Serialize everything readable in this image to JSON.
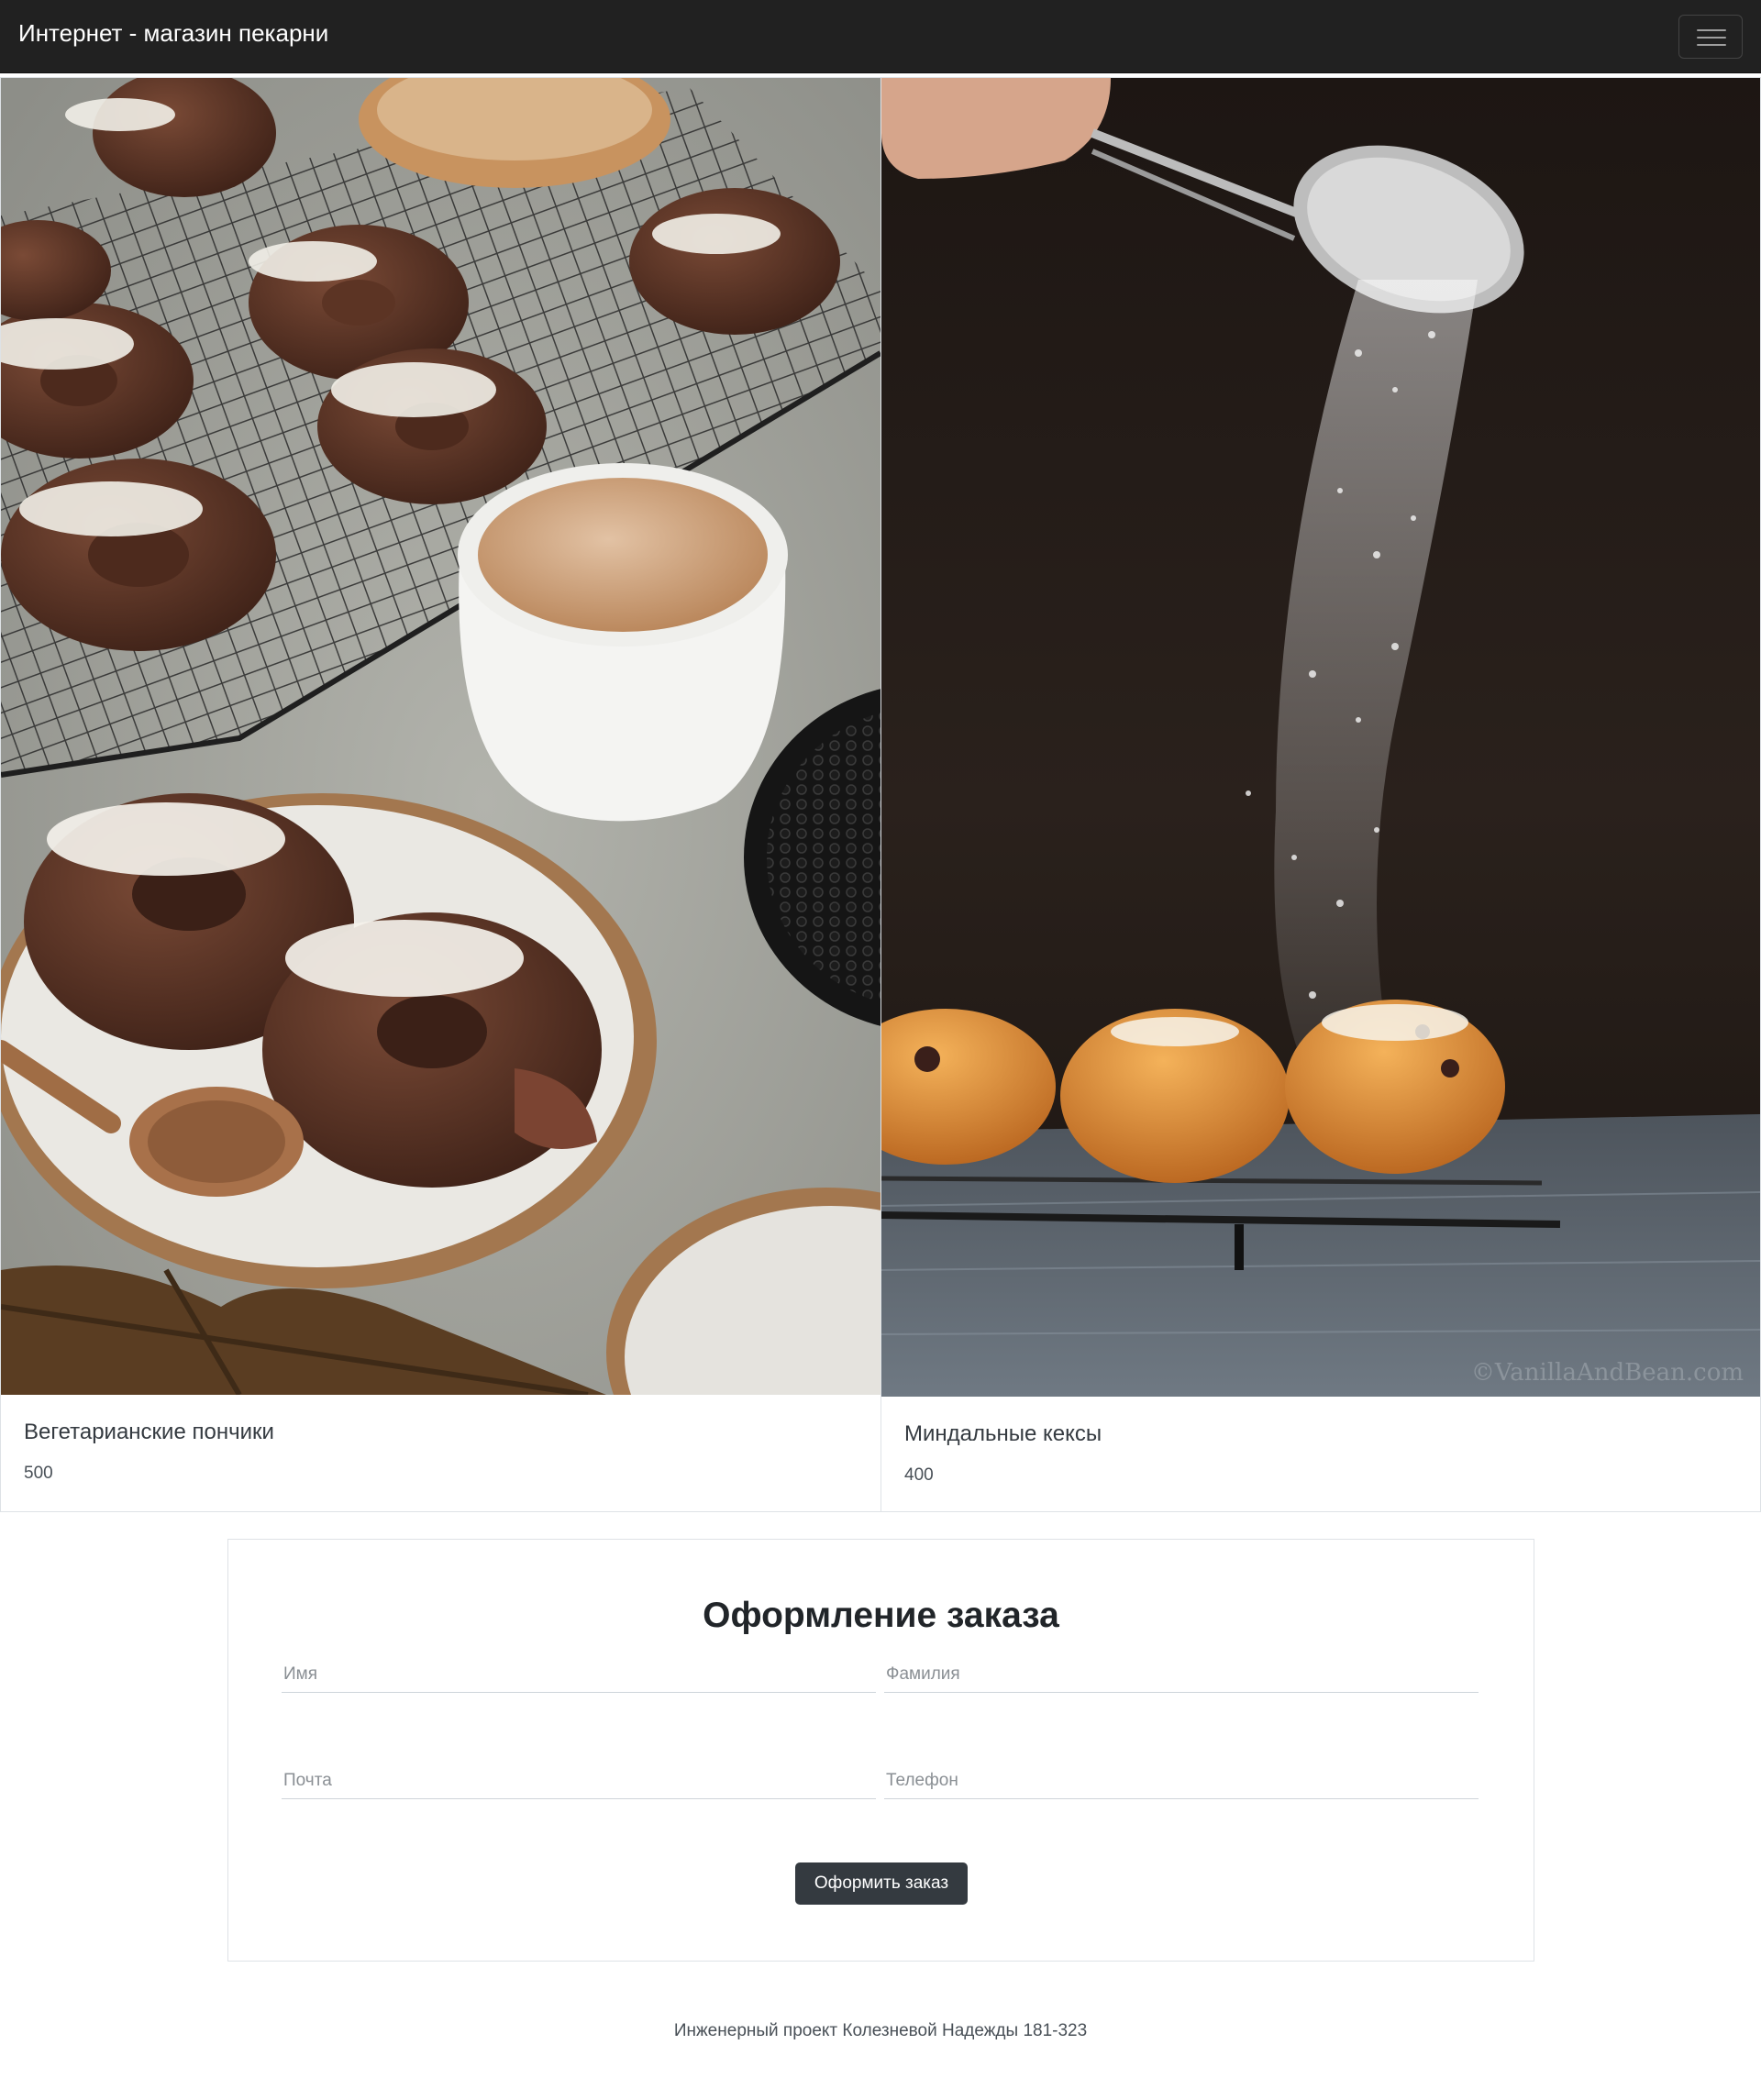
{
  "navbar": {
    "brand": "Интернет - магазин пекарни",
    "toggler_icon": "hamburger-menu-icon"
  },
  "products": [
    {
      "image": "donuts-coffee-photo",
      "title": "Вегетарианские пончики",
      "price": "500"
    },
    {
      "image": "muffins-powdered-sugar-photo",
      "title": "Миндальные кексы",
      "price": "400"
    }
  ],
  "order_form": {
    "title": "Оформление заказа",
    "first_name_placeholder": "Имя",
    "last_name_placeholder": "Фамилия",
    "email_placeholder": "Почта",
    "phone_placeholder": "Телефон",
    "submit_label": "Оформить заказ"
  },
  "footer": {
    "text": "Инженерный проект Колезневой Надежды 181-323"
  },
  "colors": {
    "navbar_bg": "#212121",
    "button_bg": "#343a40",
    "border": "#dee2e6"
  }
}
